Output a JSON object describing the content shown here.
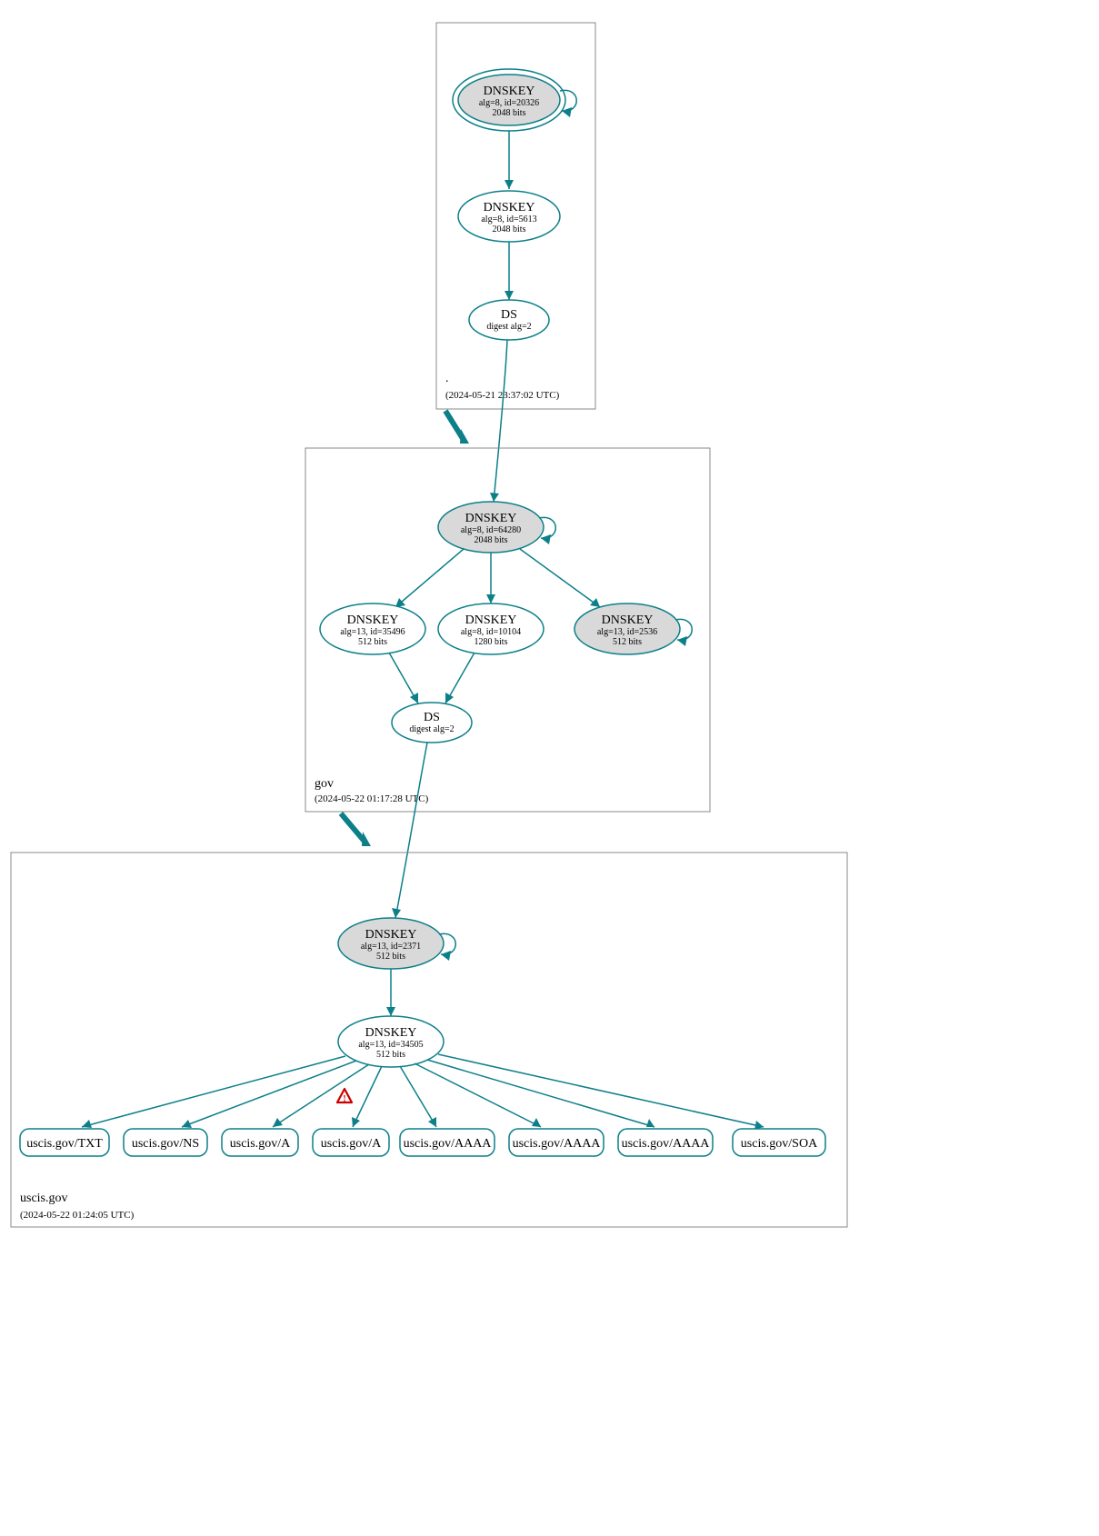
{
  "zones": {
    "root": {
      "label": ".",
      "timestamp": "(2024-05-21 23:37:02 UTC)"
    },
    "gov": {
      "label": "gov",
      "timestamp": "(2024-05-22 01:17:28 UTC)"
    },
    "uscis": {
      "label": "uscis.gov",
      "timestamp": "(2024-05-22 01:24:05 UTC)"
    }
  },
  "nodes": {
    "root_ksk": {
      "title": "DNSKEY",
      "line2": "alg=8, id=20326",
      "line3": "2048 bits"
    },
    "root_zsk": {
      "title": "DNSKEY",
      "line2": "alg=8, id=5613",
      "line3": "2048 bits"
    },
    "root_ds": {
      "title": "DS",
      "line2": "digest alg=2",
      "line3": ""
    },
    "gov_ksk": {
      "title": "DNSKEY",
      "line2": "alg=8, id=64280",
      "line3": "2048 bits"
    },
    "gov_k1": {
      "title": "DNSKEY",
      "line2": "alg=13, id=35496",
      "line3": "512 bits"
    },
    "gov_k2": {
      "title": "DNSKEY",
      "line2": "alg=8, id=10104",
      "line3": "1280 bits"
    },
    "gov_k3": {
      "title": "DNSKEY",
      "line2": "alg=13, id=2536",
      "line3": "512 bits"
    },
    "gov_ds": {
      "title": "DS",
      "line2": "digest alg=2",
      "line3": ""
    },
    "uscis_ksk": {
      "title": "DNSKEY",
      "line2": "alg=13, id=2371",
      "line3": "512 bits"
    },
    "uscis_zsk": {
      "title": "DNSKEY",
      "line2": "alg=13, id=34505",
      "line3": "512 bits"
    }
  },
  "rrsets": {
    "r0": "uscis.gov/TXT",
    "r1": "uscis.gov/NS",
    "r2": "uscis.gov/A",
    "r3": "uscis.gov/A",
    "r4": "uscis.gov/AAAA",
    "r5": "uscis.gov/AAAA",
    "r6": "uscis.gov/AAAA",
    "r7": "uscis.gov/SOA"
  }
}
